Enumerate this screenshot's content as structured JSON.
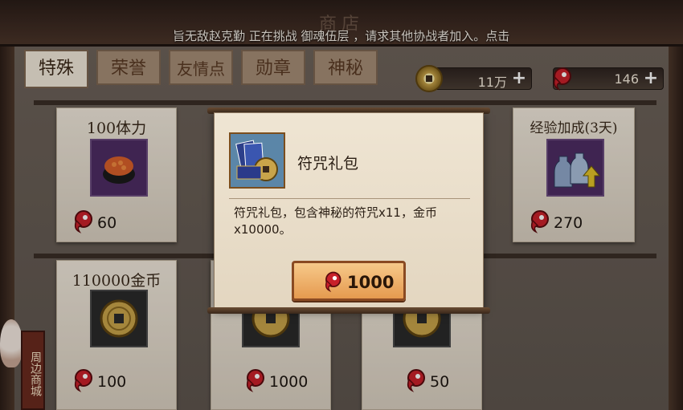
{
  "header": {
    "title": "商店",
    "ticker": "旨无敌赵克勤 正在挑战 御魂伍层 ，请求其他协战者加入。点击"
  },
  "tabs": [
    {
      "label": "特殊",
      "active": true
    },
    {
      "label": "荣誉",
      "active": false
    },
    {
      "label": "友情点",
      "active": false
    },
    {
      "label": "勋章",
      "active": false
    },
    {
      "label": "神秘",
      "active": false
    }
  ],
  "currency": {
    "coins": "11万",
    "jade": "146"
  },
  "items": [
    {
      "name": "100体力",
      "price": "60",
      "icon": "sushi-icon"
    },
    {
      "name": "经验加成(3天)",
      "price": "270",
      "icon": "sake-bottles-icon"
    },
    {
      "name": "110000金币",
      "price": "100",
      "icon": "coin-icon"
    },
    {
      "name": "",
      "price": "1000",
      "icon": "coin-icon"
    },
    {
      "name": "",
      "price": "50",
      "icon": "coin-icon"
    }
  ],
  "popup": {
    "title": "符咒礼包",
    "description": "符咒礼包，包含神秘的符咒x11，金币x10000。",
    "price": "1000",
    "icon": "talisman-pack-icon"
  },
  "side": {
    "label": "周边商城"
  },
  "colors": {
    "jade": "#c8202a",
    "button": "#e59a4f",
    "tab_active": "#f1e8d9"
  }
}
